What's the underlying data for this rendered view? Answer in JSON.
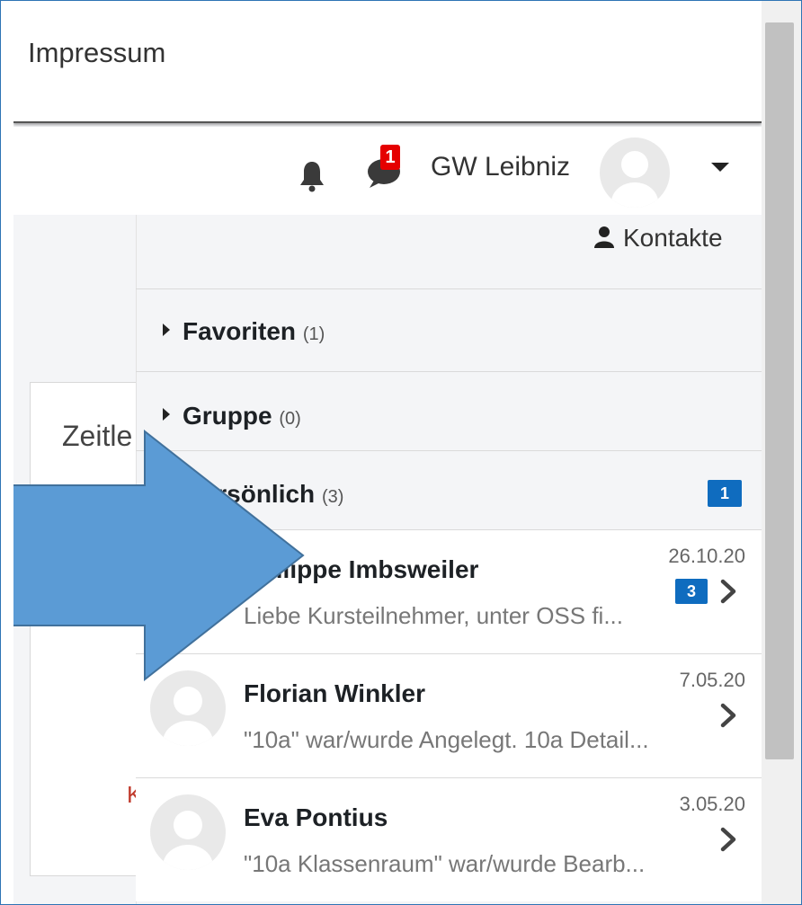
{
  "footer": {
    "impressum": "Impressum"
  },
  "navbar": {
    "notification_count": "1",
    "username": "GW Leibniz"
  },
  "background_card": {
    "title": "Zeitle",
    "k_text": "K"
  },
  "drawer": {
    "contacts_label": "Kontakte",
    "sections": [
      {
        "label": "Favoriten",
        "count": "(1)",
        "expanded": false
      },
      {
        "label": "Gruppe",
        "count": "(0)",
        "expanded": false
      },
      {
        "label": "Persönlich",
        "count": "(3)",
        "expanded": true,
        "unread": "1"
      }
    ],
    "conversations": [
      {
        "name": "Philippe Imbsweiler",
        "date": "26.10.20",
        "preview": "Liebe Kursteilnehmer, unter OSS fi...",
        "unread": "3"
      },
      {
        "name": "Florian Winkler",
        "date": "7.05.20",
        "preview": "\"10a\" war/wurde Angelegt. 10a Detail...",
        "unread": ""
      },
      {
        "name": "Eva Pontius",
        "date": "3.05.20",
        "preview": "\"10a Klassenraum\" war/wurde Bearb...",
        "unread": ""
      }
    ]
  },
  "colors": {
    "accent_blue": "#0f6cbf",
    "arrow_blue": "#5b9bd5",
    "badge_red": "#e50000"
  },
  "icons": [
    "bell-icon",
    "message-icon",
    "user-icon",
    "chevron-right-icon",
    "caret-down-icon"
  ]
}
